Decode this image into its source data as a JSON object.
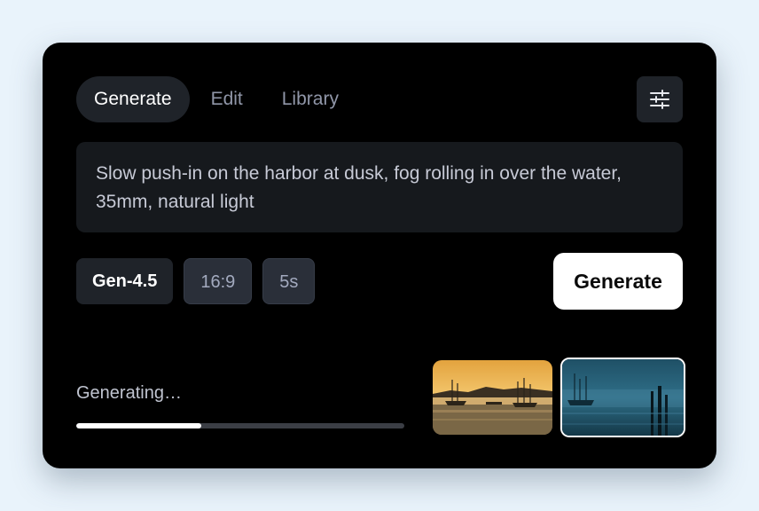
{
  "tabs": [
    {
      "label": "Generate",
      "active": true
    },
    {
      "label": "Edit",
      "active": false
    },
    {
      "label": "Library",
      "active": false
    }
  ],
  "settings_icon": "sliders-icon",
  "prompt": {
    "text": "Slow push-in on the harbor at dusk, fog rolling in over the water, 35mm, natural light"
  },
  "options": {
    "model": "Gen-4.5",
    "aspect_ratio": "16:9",
    "duration": "5s"
  },
  "generate_button": "Generate",
  "status": {
    "text": "Generating…",
    "progress": 0.38
  },
  "thumbnails": [
    {
      "scene": "harbor-sunset",
      "selected": false
    },
    {
      "scene": "harbor-fog-blue",
      "selected": true
    }
  ],
  "colors": {
    "background": "#e9f3fb",
    "card": "#000000",
    "accent": "#ffffff"
  }
}
